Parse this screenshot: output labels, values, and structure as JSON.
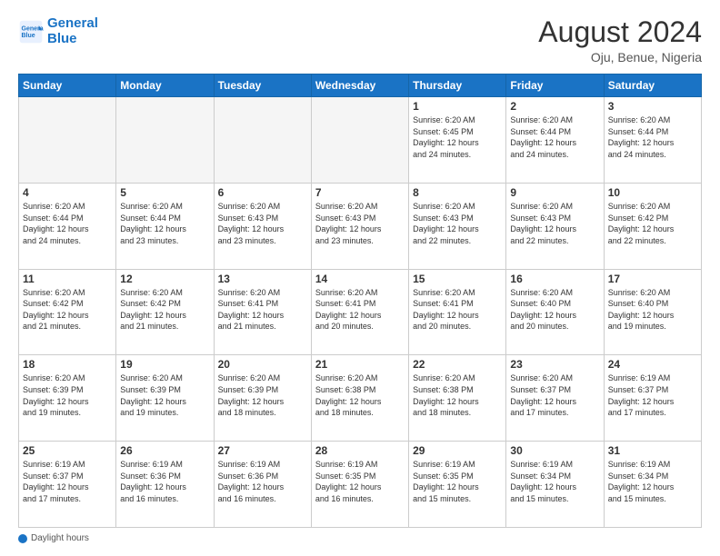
{
  "header": {
    "logo_line1": "General",
    "logo_line2": "Blue",
    "month_year": "August 2024",
    "location": "Oju, Benue, Nigeria"
  },
  "days_of_week": [
    "Sunday",
    "Monday",
    "Tuesday",
    "Wednesday",
    "Thursday",
    "Friday",
    "Saturday"
  ],
  "legend": {
    "daylight_label": "Daylight hours"
  },
  "weeks": [
    {
      "days": [
        {
          "num": "",
          "info": ""
        },
        {
          "num": "",
          "info": ""
        },
        {
          "num": "",
          "info": ""
        },
        {
          "num": "",
          "info": ""
        },
        {
          "num": "1",
          "info": "Sunrise: 6:20 AM\nSunset: 6:45 PM\nDaylight: 12 hours\nand 24 minutes."
        },
        {
          "num": "2",
          "info": "Sunrise: 6:20 AM\nSunset: 6:44 PM\nDaylight: 12 hours\nand 24 minutes."
        },
        {
          "num": "3",
          "info": "Sunrise: 6:20 AM\nSunset: 6:44 PM\nDaylight: 12 hours\nand 24 minutes."
        }
      ]
    },
    {
      "days": [
        {
          "num": "4",
          "info": "Sunrise: 6:20 AM\nSunset: 6:44 PM\nDaylight: 12 hours\nand 24 minutes."
        },
        {
          "num": "5",
          "info": "Sunrise: 6:20 AM\nSunset: 6:44 PM\nDaylight: 12 hours\nand 23 minutes."
        },
        {
          "num": "6",
          "info": "Sunrise: 6:20 AM\nSunset: 6:43 PM\nDaylight: 12 hours\nand 23 minutes."
        },
        {
          "num": "7",
          "info": "Sunrise: 6:20 AM\nSunset: 6:43 PM\nDaylight: 12 hours\nand 23 minutes."
        },
        {
          "num": "8",
          "info": "Sunrise: 6:20 AM\nSunset: 6:43 PM\nDaylight: 12 hours\nand 22 minutes."
        },
        {
          "num": "9",
          "info": "Sunrise: 6:20 AM\nSunset: 6:43 PM\nDaylight: 12 hours\nand 22 minutes."
        },
        {
          "num": "10",
          "info": "Sunrise: 6:20 AM\nSunset: 6:42 PM\nDaylight: 12 hours\nand 22 minutes."
        }
      ]
    },
    {
      "days": [
        {
          "num": "11",
          "info": "Sunrise: 6:20 AM\nSunset: 6:42 PM\nDaylight: 12 hours\nand 21 minutes."
        },
        {
          "num": "12",
          "info": "Sunrise: 6:20 AM\nSunset: 6:42 PM\nDaylight: 12 hours\nand 21 minutes."
        },
        {
          "num": "13",
          "info": "Sunrise: 6:20 AM\nSunset: 6:41 PM\nDaylight: 12 hours\nand 21 minutes."
        },
        {
          "num": "14",
          "info": "Sunrise: 6:20 AM\nSunset: 6:41 PM\nDaylight: 12 hours\nand 20 minutes."
        },
        {
          "num": "15",
          "info": "Sunrise: 6:20 AM\nSunset: 6:41 PM\nDaylight: 12 hours\nand 20 minutes."
        },
        {
          "num": "16",
          "info": "Sunrise: 6:20 AM\nSunset: 6:40 PM\nDaylight: 12 hours\nand 20 minutes."
        },
        {
          "num": "17",
          "info": "Sunrise: 6:20 AM\nSunset: 6:40 PM\nDaylight: 12 hours\nand 19 minutes."
        }
      ]
    },
    {
      "days": [
        {
          "num": "18",
          "info": "Sunrise: 6:20 AM\nSunset: 6:39 PM\nDaylight: 12 hours\nand 19 minutes."
        },
        {
          "num": "19",
          "info": "Sunrise: 6:20 AM\nSunset: 6:39 PM\nDaylight: 12 hours\nand 19 minutes."
        },
        {
          "num": "20",
          "info": "Sunrise: 6:20 AM\nSunset: 6:39 PM\nDaylight: 12 hours\nand 18 minutes."
        },
        {
          "num": "21",
          "info": "Sunrise: 6:20 AM\nSunset: 6:38 PM\nDaylight: 12 hours\nand 18 minutes."
        },
        {
          "num": "22",
          "info": "Sunrise: 6:20 AM\nSunset: 6:38 PM\nDaylight: 12 hours\nand 18 minutes."
        },
        {
          "num": "23",
          "info": "Sunrise: 6:20 AM\nSunset: 6:37 PM\nDaylight: 12 hours\nand 17 minutes."
        },
        {
          "num": "24",
          "info": "Sunrise: 6:19 AM\nSunset: 6:37 PM\nDaylight: 12 hours\nand 17 minutes."
        }
      ]
    },
    {
      "days": [
        {
          "num": "25",
          "info": "Sunrise: 6:19 AM\nSunset: 6:37 PM\nDaylight: 12 hours\nand 17 minutes."
        },
        {
          "num": "26",
          "info": "Sunrise: 6:19 AM\nSunset: 6:36 PM\nDaylight: 12 hours\nand 16 minutes."
        },
        {
          "num": "27",
          "info": "Sunrise: 6:19 AM\nSunset: 6:36 PM\nDaylight: 12 hours\nand 16 minutes."
        },
        {
          "num": "28",
          "info": "Sunrise: 6:19 AM\nSunset: 6:35 PM\nDaylight: 12 hours\nand 16 minutes."
        },
        {
          "num": "29",
          "info": "Sunrise: 6:19 AM\nSunset: 6:35 PM\nDaylight: 12 hours\nand 15 minutes."
        },
        {
          "num": "30",
          "info": "Sunrise: 6:19 AM\nSunset: 6:34 PM\nDaylight: 12 hours\nand 15 minutes."
        },
        {
          "num": "31",
          "info": "Sunrise: 6:19 AM\nSunset: 6:34 PM\nDaylight: 12 hours\nand 15 minutes."
        }
      ]
    }
  ]
}
